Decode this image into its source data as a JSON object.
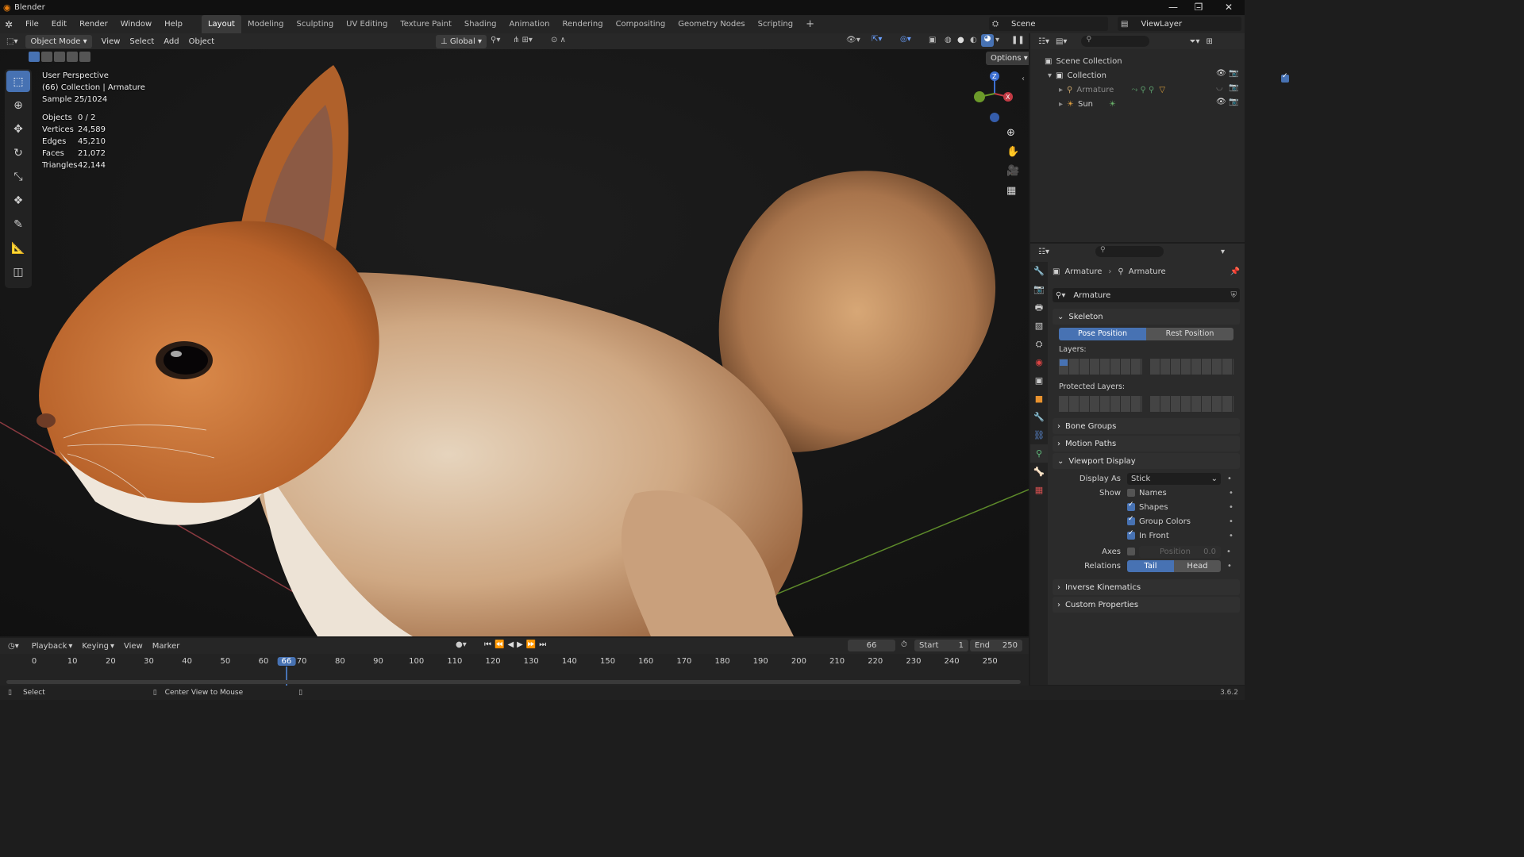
{
  "app": {
    "title": "Blender",
    "version": "3.6.2"
  },
  "menus": [
    "File",
    "Edit",
    "Render",
    "Window",
    "Help"
  ],
  "workspaces": [
    "Layout",
    "Modeling",
    "Sculpting",
    "UV Editing",
    "Texture Paint",
    "Shading",
    "Animation",
    "Rendering",
    "Compositing",
    "Geometry Nodes",
    "Scripting"
  ],
  "active_workspace": "Layout",
  "scene": {
    "name": "Scene",
    "view_layer": "ViewLayer"
  },
  "viewport_header": {
    "mode": "Object Mode",
    "menus": [
      "View",
      "Select",
      "Add",
      "Object"
    ],
    "transform": "Global",
    "options": "Options"
  },
  "overlay": {
    "lines": [
      "User Perspective",
      "(66) Collection | Armature",
      "Sample 25/1024"
    ],
    "stats": [
      [
        "Objects",
        "0 / 2"
      ],
      [
        "Vertices",
        "24,589"
      ],
      [
        "Edges",
        "45,210"
      ],
      [
        "Faces",
        "21,072"
      ],
      [
        "Triangles",
        "42,144"
      ]
    ]
  },
  "gizmo": {
    "z": "Z",
    "x": "X"
  },
  "outliner": {
    "root": "Scene Collection",
    "collection": "Collection",
    "items": [
      {
        "name": "Armature",
        "icon": "armature-icon"
      },
      {
        "name": "Sun",
        "icon": "sun-icon"
      }
    ]
  },
  "properties": {
    "breadcrumb": [
      "Armature",
      "Armature"
    ],
    "datablock": "Armature",
    "skeleton": {
      "title": "Skeleton",
      "pose": "Pose Position",
      "rest": "Rest Position",
      "layers": "Layers:",
      "protected": "Protected Layers:"
    },
    "collapsed_top": [
      "Bone Groups",
      "Motion Paths"
    ],
    "viewport_display": {
      "title": "Viewport Display",
      "display_as_label": "Display As",
      "display_as": "Stick",
      "show_label": "Show",
      "shows": [
        {
          "label": "Names",
          "on": false
        },
        {
          "label": "Shapes",
          "on": true
        },
        {
          "label": "Group Colors",
          "on": true
        },
        {
          "label": "In Front",
          "on": true
        }
      ],
      "axes_label": "Axes",
      "axes_pos_label": "Position",
      "axes_pos": "0.0",
      "relations_label": "Relations",
      "tail": "Tail",
      "head": "Head"
    },
    "collapsed_bottom": [
      "Inverse Kinematics",
      "Custom Properties"
    ]
  },
  "timeline": {
    "menus": [
      "Playback",
      "Keying",
      "View",
      "Marker"
    ],
    "current": "66",
    "start_label": "Start",
    "start": "1",
    "end_label": "End",
    "end": "250",
    "ticks": [
      "0",
      "10",
      "20",
      "30",
      "40",
      "50",
      "60",
      "66",
      "70",
      "80",
      "90",
      "100",
      "110",
      "120",
      "130",
      "140",
      "150",
      "160",
      "170",
      "180",
      "190",
      "200",
      "210",
      "220",
      "230",
      "240",
      "250"
    ]
  },
  "status": {
    "left": "Select",
    "mid": "Center View to Mouse",
    "version": "3.6.2"
  },
  "colors": {
    "accent": "#4772b3",
    "fur_orange": "#c46a2c",
    "fur_cream": "#d9c2a6"
  }
}
